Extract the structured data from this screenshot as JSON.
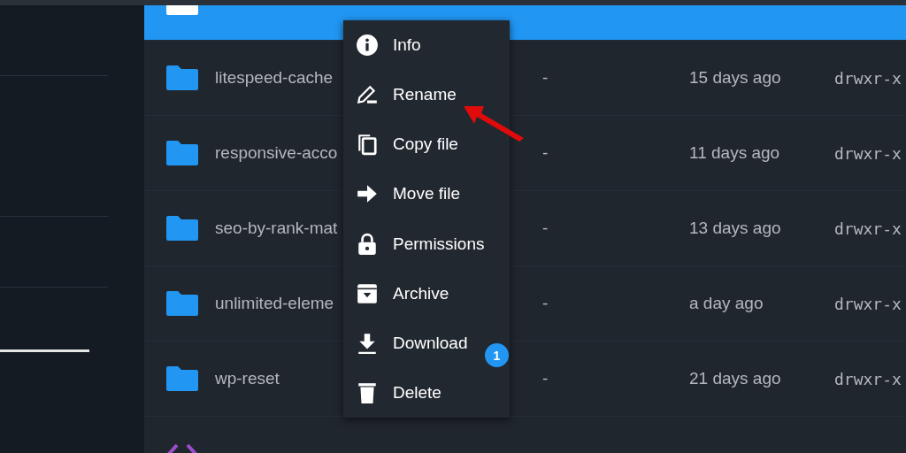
{
  "files": [
    {
      "kind": "folder",
      "selected": true
    },
    {
      "kind": "folder",
      "name": "litespeed-cache",
      "size": "-",
      "modified": "15 days ago",
      "permissions": "drwxr-x",
      "selected": false
    },
    {
      "kind": "folder",
      "name": "responsive-acco",
      "size": "-",
      "modified": "11 days ago",
      "permissions": "drwxr-x",
      "selected": false
    },
    {
      "kind": "folder",
      "name": "seo-by-rank-mat",
      "size": "-",
      "modified": "13 days ago",
      "permissions": "drwxr-x",
      "selected": false
    },
    {
      "kind": "folder",
      "name": "unlimited-eleme",
      "size": "-",
      "modified": "a day ago",
      "permissions": "drwxr-x",
      "selected": false
    },
    {
      "kind": "folder",
      "name": "wp-reset",
      "size": "-",
      "modified": "21 days ago",
      "permissions": "drwxr-x",
      "selected": false
    },
    {
      "kind": "code",
      "selected": false
    }
  ],
  "context_menu": {
    "items": [
      {
        "label": "Info"
      },
      {
        "label": "Rename"
      },
      {
        "label": "Copy file"
      },
      {
        "label": "Move file"
      },
      {
        "label": "Permissions"
      },
      {
        "label": "Archive"
      },
      {
        "label": "Download"
      },
      {
        "label": "Delete"
      }
    ]
  },
  "badge": "1"
}
